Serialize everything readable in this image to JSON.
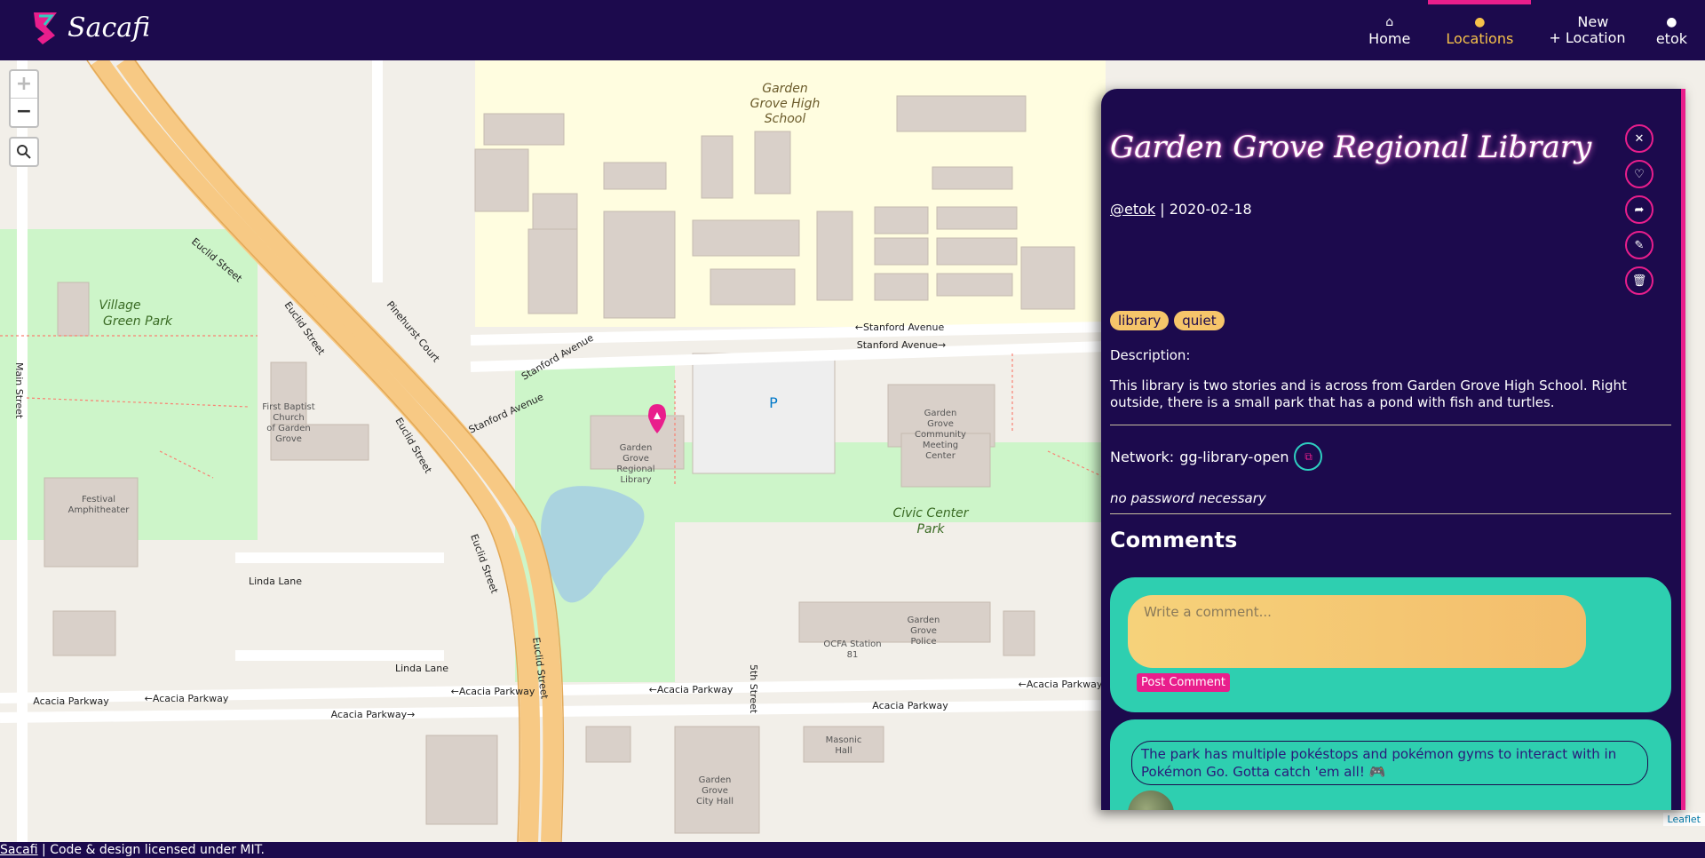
{
  "brand": {
    "name": "Sacafi"
  },
  "nav": {
    "items": [
      {
        "label": "Home",
        "icon": "home-icon",
        "active": false
      },
      {
        "label": "Locations",
        "icon": "map-pin-icon",
        "active": true
      },
      {
        "label": "New Location",
        "icon": "plus-icon",
        "active": false
      },
      {
        "label": "etok",
        "icon": "user-icon",
        "active": false
      }
    ]
  },
  "map": {
    "zoom_in": "+",
    "zoom_out": "−",
    "attribution": "Leaflet",
    "labels": {
      "garden_grove_high": "Garden Grove High School",
      "village_green": "Village Green Park",
      "stanford_ave": "Stanford Avenue",
      "euclid_st": "Euclid Street",
      "pinehurst": "Pinehurst Court",
      "main_st": "Main Street",
      "first_baptist": "First Baptist Church of Garden Grove",
      "festival": "Festival Amphitheater",
      "library": "Garden Grove Regional Library",
      "community": "Garden Grove Community Meeting Center",
      "civic_center": "Civic Center Park",
      "linda_lane": "Linda Lane",
      "acacia": "Acacia Parkway",
      "ocfa": "OCFA Station 81",
      "police": "Garden Grove Police",
      "masonic": "Masonic Hall",
      "city_hall": "Garden Grove City Hall",
      "fifth_st": "5th Street",
      "parking": "P"
    }
  },
  "location": {
    "title": "Garden Grove Regional Library",
    "author": "@etok",
    "date": "2020-02-18",
    "tags": [
      "library",
      "quiet"
    ],
    "description_label": "Description:",
    "description": "This library is two stories and is across from Garden Grove High School. Right outside, there is a small park that has a pond with fish and turtles.",
    "network_label": "Network:",
    "network": "gg-library-open",
    "password_note": "no password necessary"
  },
  "comments": {
    "heading": "Comments",
    "placeholder": "Write a comment...",
    "post_label": "Post Comment",
    "items": [
      {
        "text": "The park has multiple pokéstops and pokémon gyms to interact with in Pokémon Go. Gotta catch 'em all! 🎮"
      }
    ]
  },
  "footer": {
    "link": "Sacafi",
    "text": "Code & design licensed under MIT."
  },
  "colors": {
    "nav_bg": "#1c0a4d",
    "accent_pink": "#e91e8c",
    "accent_gold": "#f6c24a",
    "card_teal": "#2ecfb0"
  }
}
